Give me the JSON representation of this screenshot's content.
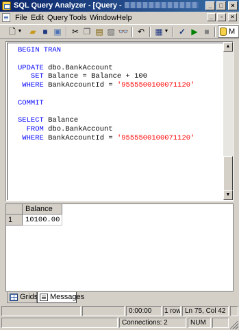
{
  "window": {
    "title": "SQL Query Analyzer - [Query -"
  },
  "menu": [
    {
      "label": "File"
    },
    {
      "label": "Edit"
    },
    {
      "label": "Query"
    },
    {
      "label": "Tools"
    },
    {
      "label": "Window"
    },
    {
      "label": "Help"
    }
  ],
  "toolbar": {
    "buttons": [
      "new-query-icon",
      "dropdown-arrow-icon",
      "open-icon",
      "save-icon",
      "load-script-icon",
      "cut-icon",
      "copy-icon",
      "paste-icon",
      "clear-icon",
      "find-icon",
      "undo-icon",
      "results-mode-icon",
      "parse-icon",
      "execute-icon",
      "stop-icon"
    ],
    "database_text": "M"
  },
  "editor": {
    "lines": [
      [
        {
          "t": "BEGIN TRAN",
          "c": "kw"
        }
      ],
      [],
      [
        {
          "t": "UPDATE ",
          "c": "kw"
        },
        {
          "t": "dbo.BankAccount",
          "c": "tx"
        }
      ],
      [
        {
          "t": "   SET ",
          "c": "kw"
        },
        {
          "t": "Balance = Balance + 100",
          "c": "tx"
        }
      ],
      [
        {
          "t": " WHERE ",
          "c": "kw"
        },
        {
          "t": "BankAccountId = ",
          "c": "tx"
        },
        {
          "t": "'9555500100071120'",
          "c": "st"
        }
      ],
      [],
      [
        {
          "t": "COMMIT",
          "c": "kw"
        }
      ],
      [],
      [
        {
          "t": "SELECT ",
          "c": "kw"
        },
        {
          "t": "Balance",
          "c": "tx"
        }
      ],
      [
        {
          "t": "  FROM ",
          "c": "kw"
        },
        {
          "t": "dbo.BankAccount",
          "c": "tx"
        }
      ],
      [
        {
          "t": " WHERE ",
          "c": "kw"
        },
        {
          "t": "BankAccountId = ",
          "c": "tx"
        },
        {
          "t": "'9555500100071120'",
          "c": "st"
        }
      ]
    ]
  },
  "results": {
    "columns": [
      "Balance"
    ],
    "rows": [
      {
        "num": "1",
        "cells": [
          "10100.00"
        ]
      }
    ]
  },
  "tabs": [
    {
      "label": "Grids",
      "active": false
    },
    {
      "label": "Messages",
      "active": true
    }
  ],
  "status": {
    "time": "0:00:00",
    "rows": "1 rows",
    "position": "Ln 75, Col 42",
    "connections": "Connections: 2",
    "num": "NUM"
  },
  "colors": {
    "keyword": "#0000ff",
    "string": "#ff0000",
    "title_gradient_start": "#0a246a",
    "title_gradient_end": "#3a6ea5",
    "chrome": "#d4d0c8"
  }
}
